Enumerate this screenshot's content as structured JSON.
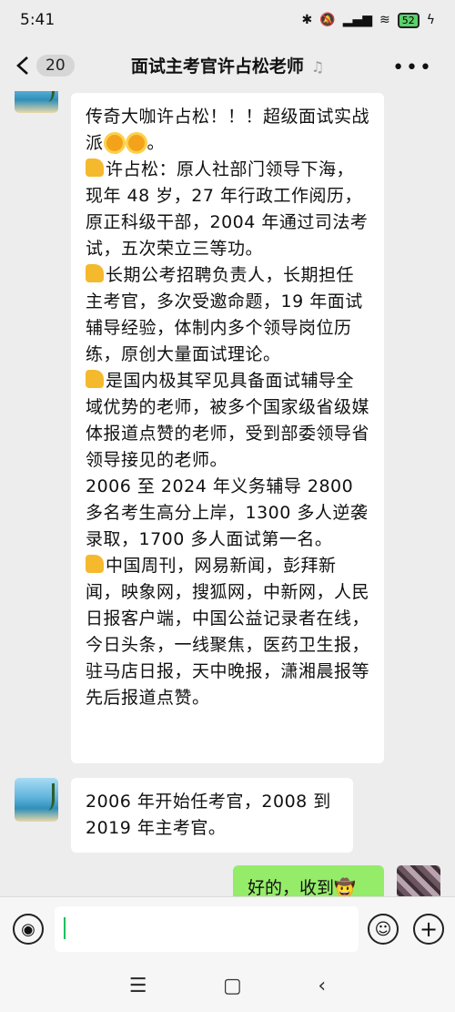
{
  "status": {
    "time": "5:41",
    "battery": "52"
  },
  "header": {
    "back_count": "20",
    "title": "面试主考官许占松老师"
  },
  "messages": {
    "m1": [
      "传奇大咖许占松！！！超级面试实战派",
      "许占松：原人社部门领导下海，现年 48 岁，27 年行政工作阅历，原正科级干部，2004 年通过司法考试，五次荣立三等功。",
      "长期公考招聘负责人，长期担任主考官，多次受邀命题，19 年面试辅导经验，体制内多个领导岗位历练，原创大量面试理论。",
      "是国内极其罕见具备面试辅导全域优势的老师，被多个国家级省级媒体报道点赞的老师，受到部委领导省领导接见的老师。",
      "2006 至 2024 年义务辅导 2800 多名考生高分上岸，1300 多人逆袭录取，1700 多人面试第一名。",
      "中国周刊，网易新闻，彭拜新闻，映象网，搜狐网，中新网，人民日报客户端，中国公益记录者在线，今日头条，一线聚焦，医药卫生报，驻马店日报，天中晚报，潇湘晨报等先后报道点赞。"
    ],
    "m2": "2006 年开始任考官，2008 到 2019 年主考官。",
    "m3": "好的，收到"
  }
}
